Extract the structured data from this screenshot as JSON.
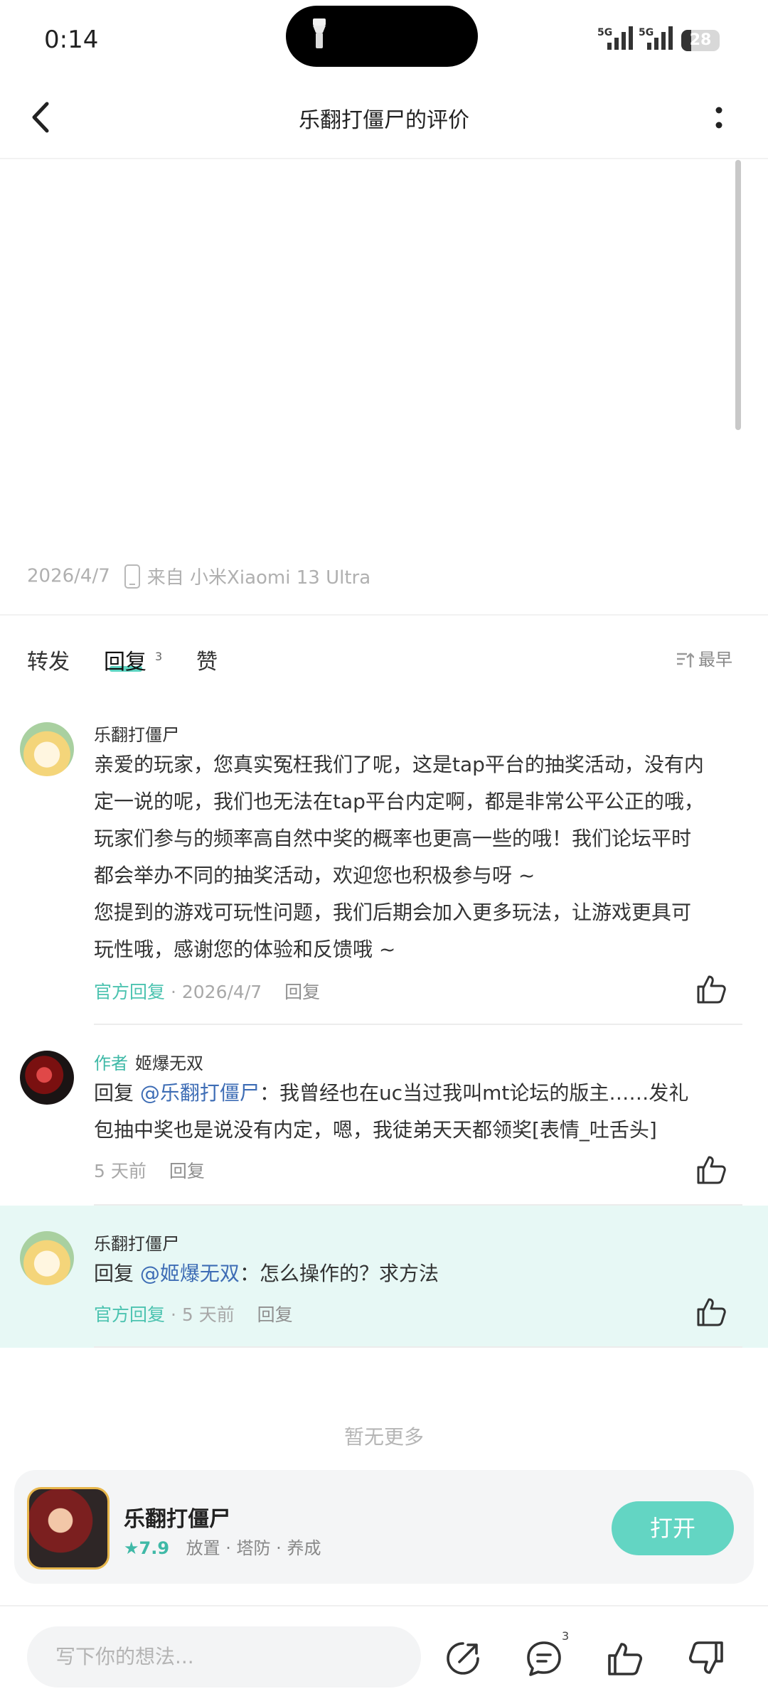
{
  "status_bar": {
    "time": "0:14",
    "signal_1": "5G",
    "signal_2": "5G",
    "battery": "28"
  },
  "header": {
    "title": "乐翻打僵尸的评价"
  },
  "post_meta": {
    "date": "2026/4/7",
    "device": "来自 小米Xiaomi 13 Ultra"
  },
  "tabs": {
    "forward": "转发",
    "reply": "回复",
    "reply_count": "3",
    "like": "赞",
    "sort": "最早"
  },
  "comments": [
    {
      "name": "乐翻打僵尸",
      "text_lines": [
        "亲爱的玩家，您真实冤枉我们了呢，这是tap平台的抽奖活动，没有内",
        "定一说的呢，我们也无法在tap平台内定啊，都是非常公平公正的哦，",
        "玩家们参与的频率高自然中奖的概率也更高一些的哦！我们论坛平时",
        "都会举办不同的抽奖活动，欢迎您也积极参与呀 ~",
        "您提到的游戏可玩性问题，我们后期会加入更多玩法，让游戏更具可",
        "玩性哦，感谢您的体验和反馈哦 ~"
      ],
      "badge": "官方回复",
      "time": "· 2026/4/7",
      "reply": "回复"
    },
    {
      "author_tag": "作者",
      "name": "姬爆无双",
      "reply_prefix": "回复",
      "mention": "@乐翻打僵尸",
      "text_line1": "：我曾经也在uc当过我叫mt论坛的版主……发礼",
      "text_line2": "包抽中奖也是说没有内定，嗯，我徒弟天天都领奖[表情_吐舌头]",
      "time": "5 天前",
      "reply": "回复"
    },
    {
      "name": "乐翻打僵尸",
      "reply_prefix": "回复",
      "mention": "@姬爆无双",
      "text": "：怎么操作的？求方法",
      "badge": "官方回复",
      "time": "· 5 天前",
      "reply": "回复"
    }
  ],
  "no_more": "暂无更多",
  "game_card": {
    "name": "乐翻打僵尸",
    "rating": "7.9",
    "tags": "放置 · 塔防 · 养成",
    "open_button": "打开"
  },
  "bottom_bar": {
    "input_placeholder": "写下你的想法...",
    "comment_count": "3"
  },
  "colors": {
    "accent": "#5dd5c2",
    "highlight_row": "#e7f8f5",
    "mention": "#3e6db5"
  }
}
